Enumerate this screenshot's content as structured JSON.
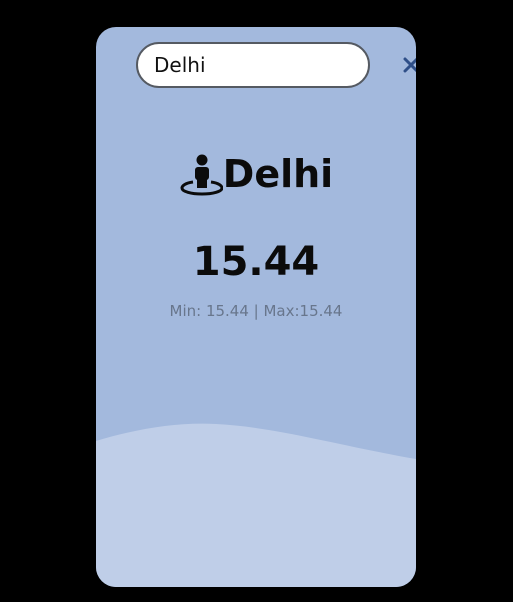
{
  "search": {
    "value": "Delhi",
    "clear_icon": "close-icon"
  },
  "weather": {
    "location_icon": "street-view-icon",
    "city": "Delhi",
    "temperature": "15.44",
    "min_max": "Min: 15.44 | Max:15.44"
  },
  "colors": {
    "page_background": "#000000",
    "card_background": "#a3b9dd",
    "wave_color": "#bfcee8",
    "clear_icon_color": "#2f4f88"
  }
}
